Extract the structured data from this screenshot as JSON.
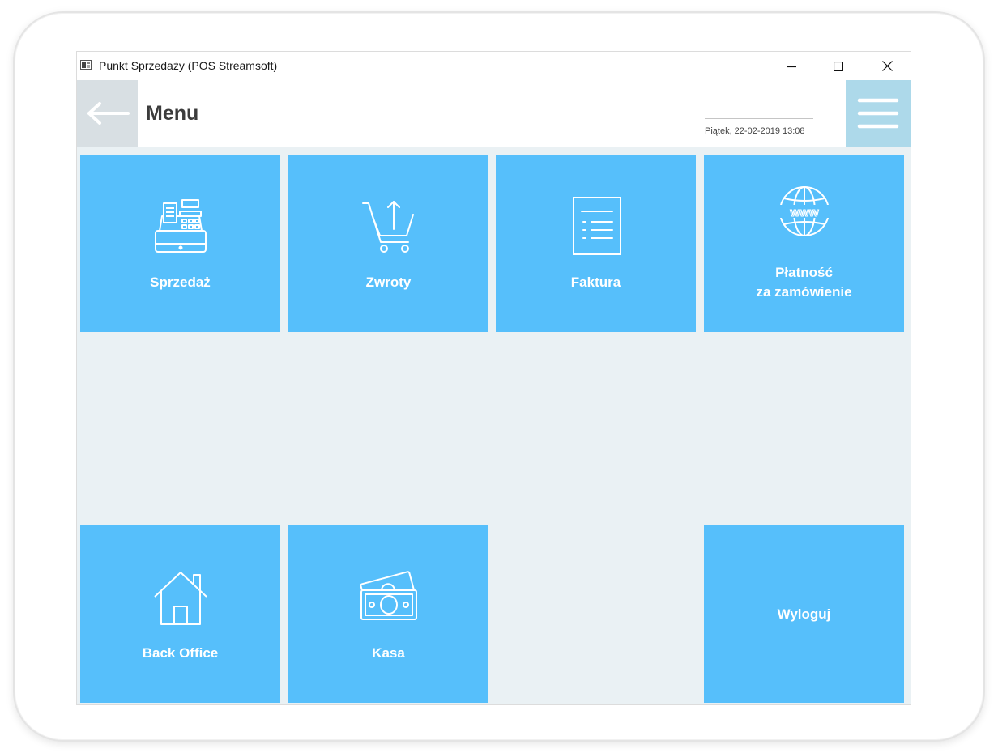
{
  "window": {
    "title": "Punkt Sprzedaży (POS Streamsoft)"
  },
  "header": {
    "title": "Menu",
    "datetime": "Piątek, 22-02-2019 13:08"
  },
  "tiles": [
    {
      "label": "Sprzedaż",
      "icon": "cash-register-icon"
    },
    {
      "label": "Zwroty",
      "icon": "cart-return-icon"
    },
    {
      "label": "Faktura",
      "icon": "invoice-icon"
    },
    {
      "label_line1": "Płatność",
      "label_line2": "za zamówienie",
      "icon": "www-globe-icon"
    },
    {
      "label": "Back Office",
      "icon": "house-icon"
    },
    {
      "label": "Kasa",
      "icon": "money-icon"
    },
    {
      "label": "Wyloguj"
    }
  ],
  "colors": {
    "tile": "#56bffb",
    "background": "#eaf1f4",
    "back_button": "#d8dfe3",
    "menu_button": "#add9ea"
  }
}
